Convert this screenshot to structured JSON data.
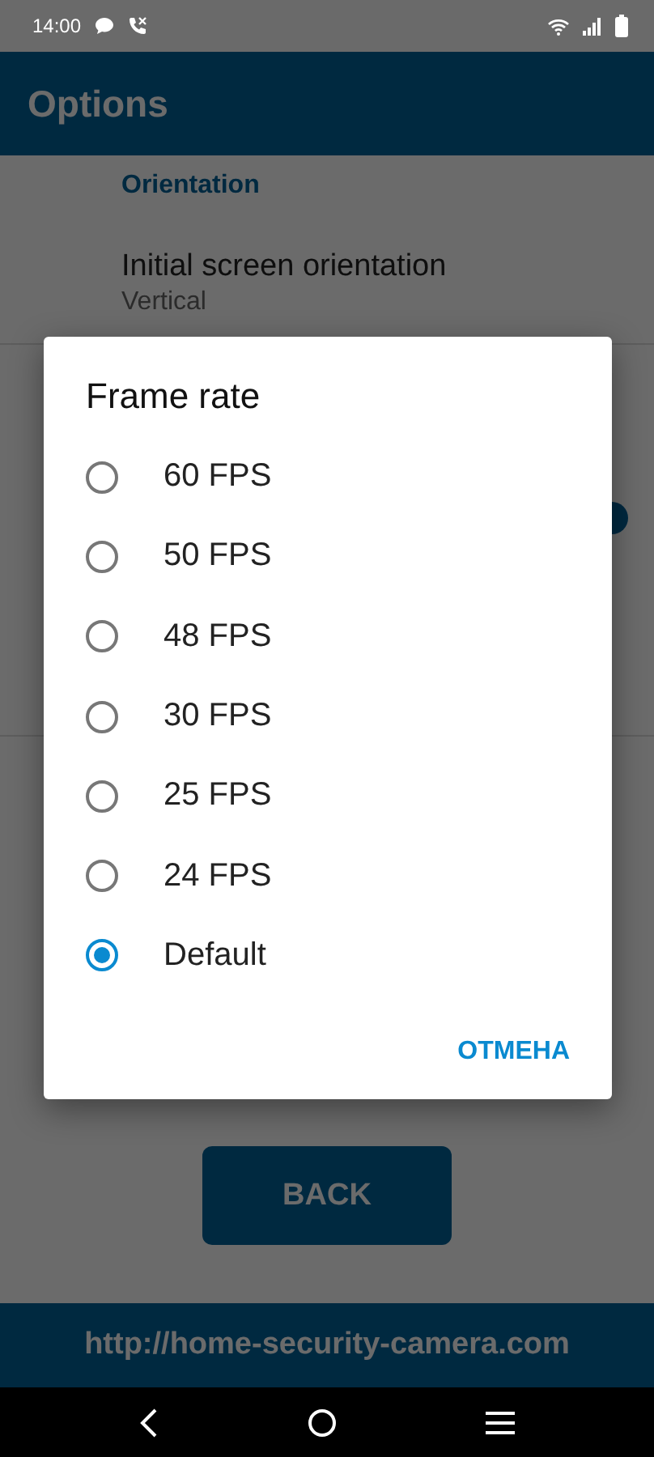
{
  "status_bar": {
    "time": "14:00"
  },
  "app_bar": {
    "title": "Options"
  },
  "preferences": {
    "category": "Orientation",
    "items": [
      {
        "title": "Initial screen orientation",
        "summary": "Vertical"
      }
    ]
  },
  "back_button": "BACK",
  "footer": {
    "url": "http://home-security-camera.com"
  },
  "dialog": {
    "title": "Frame rate",
    "options": [
      {
        "label": "60 FPS",
        "selected": false
      },
      {
        "label": "50 FPS",
        "selected": false
      },
      {
        "label": "48 FPS",
        "selected": false
      },
      {
        "label": "30 FPS",
        "selected": false
      },
      {
        "label": "25 FPS",
        "selected": false
      },
      {
        "label": "24 FPS",
        "selected": false
      },
      {
        "label": "Default",
        "selected": true
      }
    ],
    "cancel": "ОТМЕНА"
  }
}
